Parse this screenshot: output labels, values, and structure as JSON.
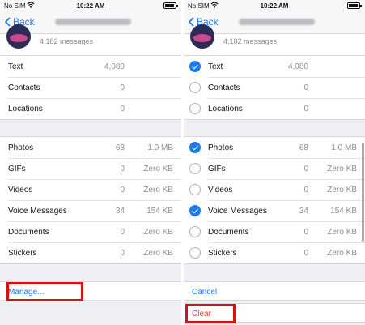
{
  "status": {
    "carrier": "No SIM",
    "time": "10:22 AM"
  },
  "nav": {
    "back_label": "Back"
  },
  "profile": {
    "messages": "4,182 messages"
  },
  "left": {
    "section1": [
      {
        "label": "Text",
        "count": "4,080"
      },
      {
        "label": "Contacts",
        "count": "0"
      },
      {
        "label": "Locations",
        "count": "0"
      }
    ],
    "section2": [
      {
        "label": "Photos",
        "count": "68",
        "size": "1.0 MB"
      },
      {
        "label": "GIFs",
        "count": "0",
        "size": "Zero KB"
      },
      {
        "label": "Videos",
        "count": "0",
        "size": "Zero KB"
      },
      {
        "label": "Voice Messages",
        "count": "34",
        "size": "154 KB"
      },
      {
        "label": "Documents",
        "count": "0",
        "size": "Zero KB"
      },
      {
        "label": "Stickers",
        "count": "0",
        "size": "Zero KB"
      }
    ],
    "manage_label": "Manage..."
  },
  "right": {
    "section1": [
      {
        "label": "Text",
        "count": "4,080",
        "checked": true
      },
      {
        "label": "Contacts",
        "count": "0",
        "checked": false
      },
      {
        "label": "Locations",
        "count": "0",
        "checked": false
      }
    ],
    "section2": [
      {
        "label": "Photos",
        "count": "68",
        "size": "1.0 MB",
        "checked": true
      },
      {
        "label": "GIFs",
        "count": "0",
        "size": "Zero KB",
        "checked": false
      },
      {
        "label": "Videos",
        "count": "0",
        "size": "Zero KB",
        "checked": false
      },
      {
        "label": "Voice Messages",
        "count": "34",
        "size": "154 KB",
        "checked": true
      },
      {
        "label": "Documents",
        "count": "0",
        "size": "Zero KB",
        "checked": false
      },
      {
        "label": "Stickers",
        "count": "0",
        "size": "Zero KB",
        "checked": false
      }
    ],
    "cancel_label": "Cancel",
    "clear_label": "Clear"
  },
  "colors": {
    "accent": "#1a7cf5",
    "destructive": "#e83434",
    "annotation": "#d51313"
  }
}
